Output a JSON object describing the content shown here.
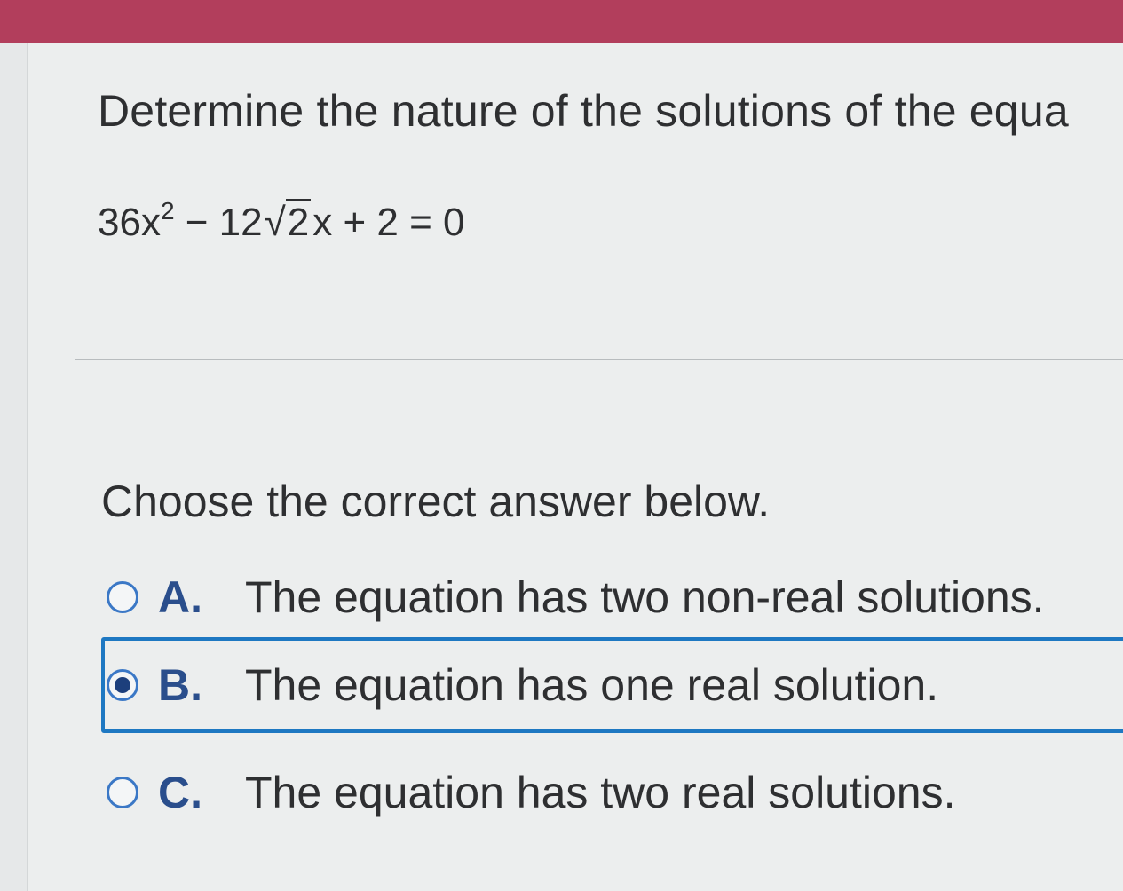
{
  "question": {
    "text": "Determine the nature of the solutions of the equa"
  },
  "equation": {
    "part1": "36x",
    "exponent": "2",
    "part2": " − 12",
    "radical": "√",
    "radicand": "2",
    "part3": "x + 2 = 0"
  },
  "prompt": "Choose the correct answer below.",
  "options": [
    {
      "letter": "A.",
      "text": "The equation has two non-real solutions.",
      "selected": false
    },
    {
      "letter": "B.",
      "text": "The equation has one real solution.",
      "selected": true
    },
    {
      "letter": "C.",
      "text": "The equation has two real solutions.",
      "selected": false
    }
  ],
  "colors": {
    "header": "#b23e5c",
    "selection_border": "#1e78c2",
    "radio": "#3b78c6"
  }
}
